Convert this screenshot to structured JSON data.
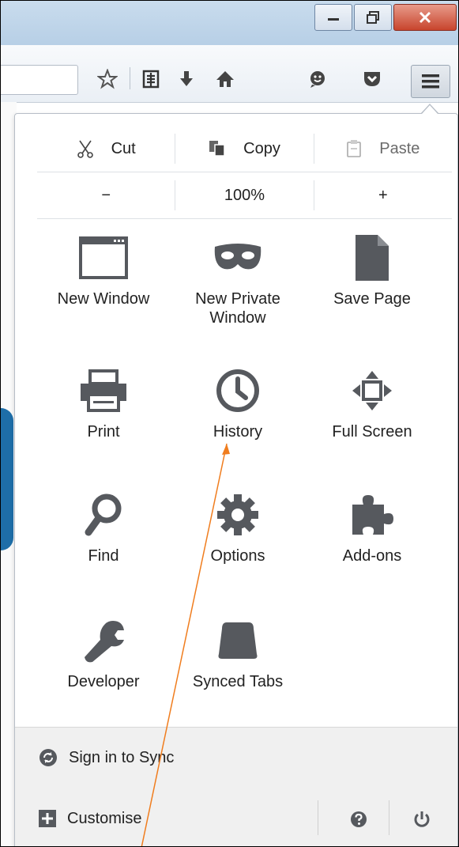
{
  "window": {
    "title_buttons": [
      "minimize",
      "restore",
      "close"
    ]
  },
  "toolbar": {
    "icons": [
      "star-icon",
      "reader-icon",
      "download-icon",
      "home-icon",
      "hello-icon",
      "pocket-icon"
    ],
    "menu_button": "hamburger-menu-icon"
  },
  "menu": {
    "edit": {
      "cut": "Cut",
      "copy": "Copy",
      "paste": "Paste"
    },
    "zoom": {
      "minus": "−",
      "level": "100%",
      "plus": "+"
    },
    "items": [
      {
        "label": "New Window",
        "icon": "window-icon"
      },
      {
        "label": "New Private Window",
        "icon": "private-mask-icon"
      },
      {
        "label": "Save Page",
        "icon": "save-page-icon"
      },
      {
        "label": "Print",
        "icon": "print-icon"
      },
      {
        "label": "History",
        "icon": "history-clock-icon"
      },
      {
        "label": "Full Screen",
        "icon": "fullscreen-icon"
      },
      {
        "label": "Find",
        "icon": "magnifier-icon"
      },
      {
        "label": "Options",
        "icon": "gear-icon"
      },
      {
        "label": "Add-ons",
        "icon": "puzzle-icon"
      },
      {
        "label": "Developer",
        "icon": "wrench-icon"
      },
      {
        "label": "Synced Tabs",
        "icon": "synced-tabs-icon"
      }
    ],
    "sync": "Sign in to Sync",
    "customise": "Customise"
  },
  "colors": {
    "icon_gray": "#56595e",
    "annotation": "#f07d1e"
  }
}
